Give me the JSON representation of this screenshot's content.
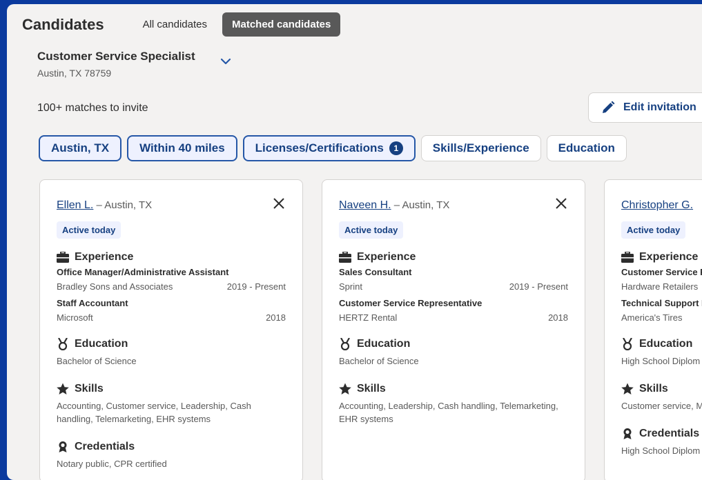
{
  "header": {
    "title": "Candidates",
    "tabs": [
      {
        "label": "All candidates",
        "active": false
      },
      {
        "label": "Matched candidates",
        "active": true
      }
    ]
  },
  "job": {
    "title": "Customer Service Specialist",
    "location": "Austin, TX 78759"
  },
  "matches_text": "100+ matches to invite",
  "edit_button": {
    "label": "Edit invitation",
    "icon": "pencil-icon"
  },
  "filters": [
    {
      "label": "Austin, TX",
      "selected": true
    },
    {
      "label": "Within 40 miles",
      "selected": true
    },
    {
      "label": "Licenses/Certifications",
      "selected": true,
      "count": "1"
    },
    {
      "label": "Skills/Experience",
      "selected": false
    },
    {
      "label": "Education",
      "selected": false
    }
  ],
  "candidates": [
    {
      "name": "Ellen L.",
      "location": "– Austin, TX",
      "status": "Active today",
      "experience_heading": "Experience",
      "experience": [
        {
          "title": "Office Manager/Administrative Assistant",
          "company": "Bradley Sons and Associates",
          "dates": "2019 - Present"
        },
        {
          "title": "Staff Accountant",
          "company": "Microsoft",
          "dates": "2018"
        }
      ],
      "education_heading": "Education",
      "education": "Bachelor of Science",
      "skills_heading": "Skills",
      "skills": "Accounting, Customer service, Leadership, Cash handling, Telemarketing, EHR systems",
      "credentials_heading": "Credentials",
      "credentials": "Notary public, CPR certified"
    },
    {
      "name": "Naveen H.",
      "location": "– Austin, TX",
      "status": "Active today",
      "experience_heading": "Experience",
      "experience": [
        {
          "title": "Sales Consultant",
          "company": "Sprint",
          "dates": "2019 - Present"
        },
        {
          "title": "Customer Service Representative",
          "company": "HERTZ Rental",
          "dates": "2018"
        }
      ],
      "education_heading": "Education",
      "education": "Bachelor of Science",
      "skills_heading": "Skills",
      "skills": "Accounting, Leadership, Cash handling, Telemarketing, EHR systems"
    },
    {
      "name": "Christopher G.",
      "location": "",
      "status": "Active today",
      "experience_heading": "Experience",
      "experience": [
        {
          "title": "Customer Service R",
          "company": "Hardware Retailers",
          "dates": ""
        },
        {
          "title": "Technical Support R",
          "company": "America's Tires",
          "dates": ""
        }
      ],
      "education_heading": "Education",
      "education": "High School Diplom",
      "skills_heading": "Skills",
      "skills": "Customer service, Mi",
      "credentials_heading": "Credentials",
      "credentials": "High School Diplom"
    }
  ],
  "colors": {
    "background": "#0b3a9e",
    "panel": "#f3f2f1",
    "accent": "#164081",
    "tab_active": "#595959"
  }
}
